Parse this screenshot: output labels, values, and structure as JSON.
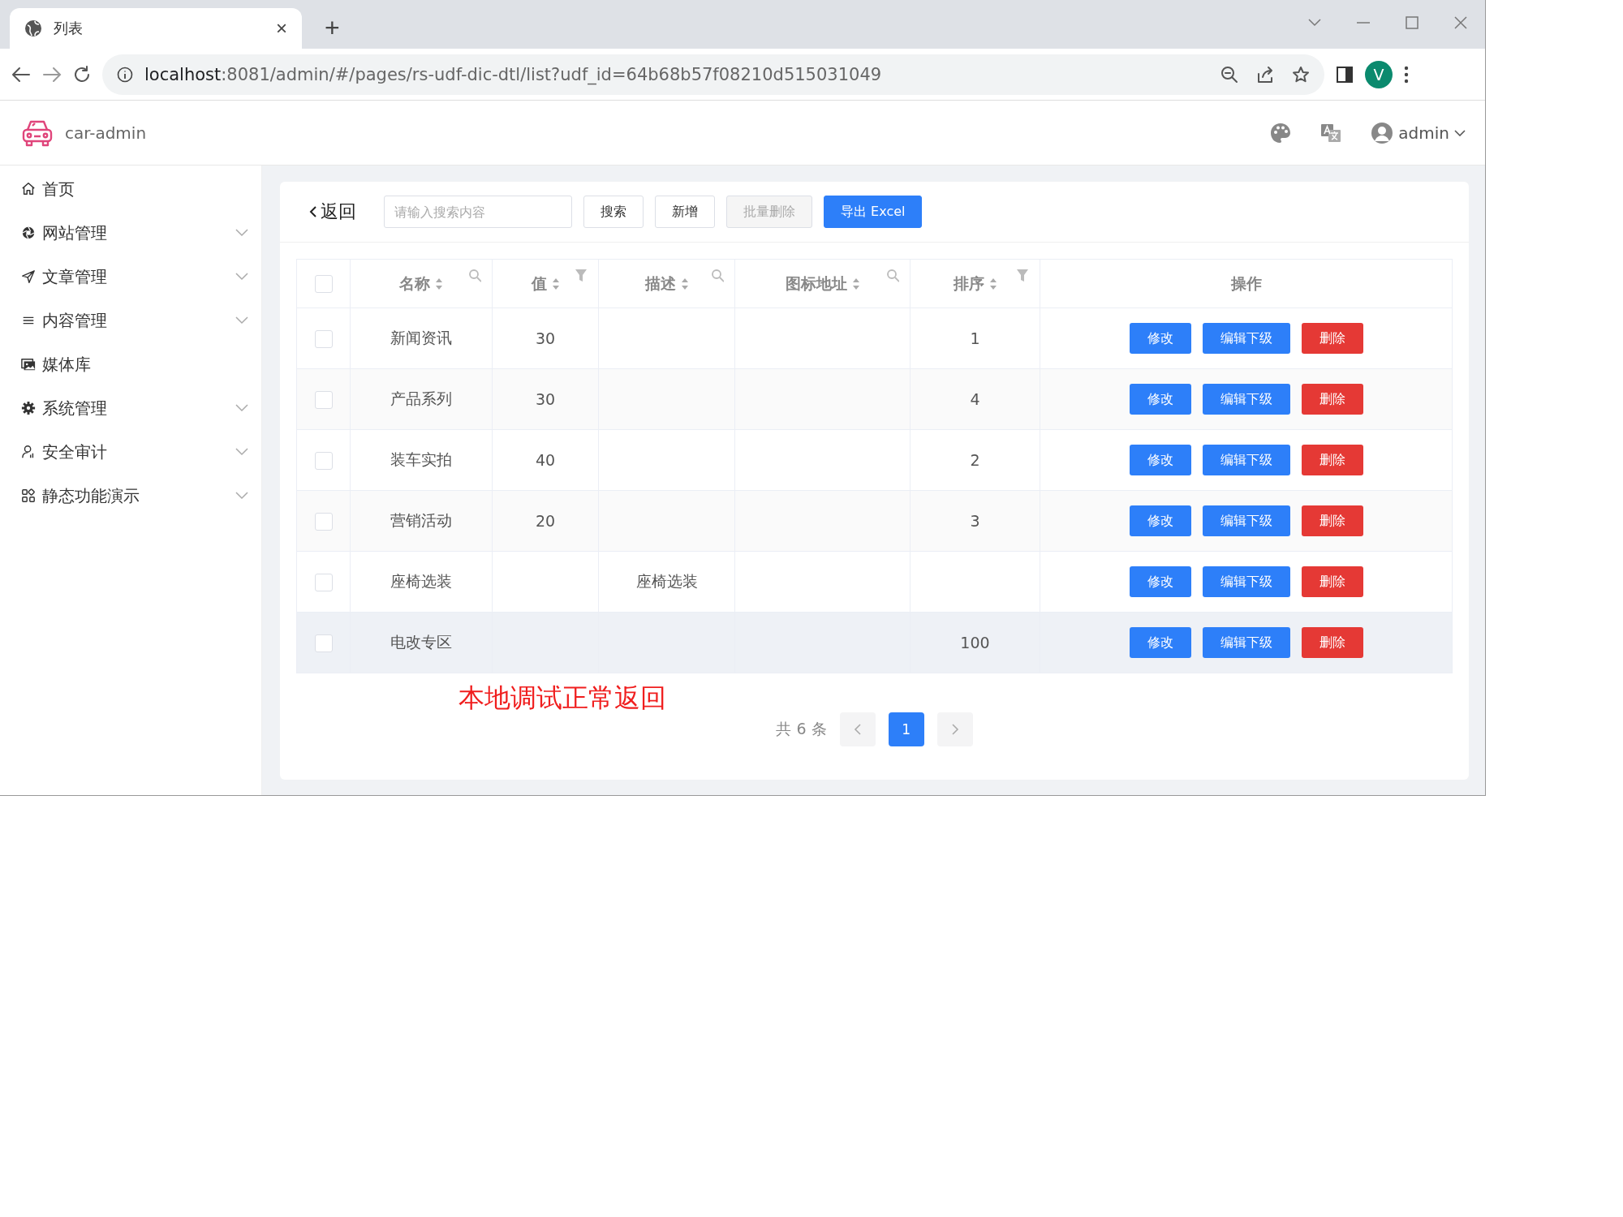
{
  "browser": {
    "tab_title": "列表",
    "tab_close": "×",
    "new_tab": "+",
    "url_host": "localhost",
    "url_rest": ":8081/admin/#/pages/rs-udf-dic-dtl/list?udf_id=64b68b57f08210d515031049",
    "profile_initial": "V"
  },
  "app": {
    "brand": "car-admin",
    "user": "admin"
  },
  "sidebar": {
    "items": [
      {
        "label": "首页",
        "expandable": false
      },
      {
        "label": "网站管理",
        "expandable": true
      },
      {
        "label": "文章管理",
        "expandable": true
      },
      {
        "label": "内容管理",
        "expandable": true
      },
      {
        "label": "媒体库",
        "expandable": false
      },
      {
        "label": "系统管理",
        "expandable": true
      },
      {
        "label": "安全审计",
        "expandable": true
      },
      {
        "label": "静态功能演示",
        "expandable": true
      }
    ]
  },
  "toolbar": {
    "back": "返回",
    "search": {
      "placeholder": "请输入搜索内容"
    },
    "buttons": [
      {
        "label": "搜索",
        "kind": "default",
        "disabled": false
      },
      {
        "label": "新增",
        "kind": "default",
        "disabled": false
      },
      {
        "label": "批量删除",
        "kind": "default",
        "disabled": true
      },
      {
        "label": "导出 Excel",
        "kind": "primary",
        "disabled": false
      }
    ]
  },
  "table": {
    "header_checkbox": {
      "checked": false
    },
    "columns": [
      {
        "label": "名称",
        "kind": "search"
      },
      {
        "label": "值",
        "kind": "filter"
      },
      {
        "label": "描述",
        "kind": "search"
      },
      {
        "label": "图标地址",
        "kind": "search"
      },
      {
        "label": "排序",
        "kind": "filter"
      },
      {
        "label": "操作",
        "kind": "plain"
      }
    ],
    "rows": [
      {
        "selected": false,
        "hovered": false,
        "cells": [
          "新闻资讯",
          "30",
          "",
          "",
          "1"
        ],
        "actions": [
          {
            "label": "修改",
            "kind": "primary"
          },
          {
            "label": "编辑下级",
            "kind": "primary"
          },
          {
            "label": "删除",
            "kind": "danger"
          }
        ]
      },
      {
        "selected": false,
        "hovered": false,
        "cells": [
          "产品系列",
          "30",
          "",
          "",
          "4"
        ],
        "actions": [
          {
            "label": "修改",
            "kind": "primary"
          },
          {
            "label": "编辑下级",
            "kind": "primary"
          },
          {
            "label": "删除",
            "kind": "danger"
          }
        ]
      },
      {
        "selected": false,
        "hovered": false,
        "cells": [
          "装车实拍",
          "40",
          "",
          "",
          "2"
        ],
        "actions": [
          {
            "label": "修改",
            "kind": "primary"
          },
          {
            "label": "编辑下级",
            "kind": "primary"
          },
          {
            "label": "删除",
            "kind": "danger"
          }
        ]
      },
      {
        "selected": false,
        "hovered": false,
        "cells": [
          "营销活动",
          "20",
          "",
          "",
          "3"
        ],
        "actions": [
          {
            "label": "修改",
            "kind": "primary"
          },
          {
            "label": "编辑下级",
            "kind": "primary"
          },
          {
            "label": "删除",
            "kind": "danger"
          }
        ]
      },
      {
        "selected": false,
        "hovered": false,
        "cells": [
          "座椅选装",
          "",
          "座椅选装",
          "",
          ""
        ],
        "actions": [
          {
            "label": "修改",
            "kind": "primary"
          },
          {
            "label": "编辑下级",
            "kind": "primary"
          },
          {
            "label": "删除",
            "kind": "danger"
          }
        ]
      },
      {
        "selected": false,
        "hovered": true,
        "cells": [
          "电改专区",
          "",
          "",
          "",
          "100"
        ],
        "actions": [
          {
            "label": "修改",
            "kind": "primary"
          },
          {
            "label": "编辑下级",
            "kind": "primary"
          },
          {
            "label": "删除",
            "kind": "danger"
          }
        ]
      }
    ]
  },
  "note": "本地调试正常返回",
  "pagination": {
    "total": "共 6 条",
    "pages": [
      {
        "label": "1",
        "selected": true
      }
    ]
  }
}
